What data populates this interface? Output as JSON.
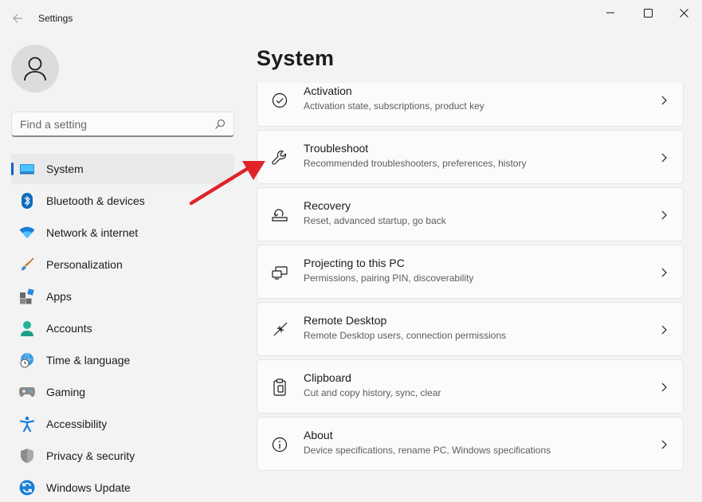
{
  "window": {
    "app_title": "Settings",
    "back_icon": "back-arrow-icon",
    "controls": [
      "minimize-icon",
      "maximize-icon",
      "close-icon"
    ]
  },
  "sidebar": {
    "avatar_icon": "user-icon",
    "search": {
      "placeholder": "Find a setting",
      "value": "",
      "icon": "search-icon"
    },
    "items": [
      {
        "label": "System",
        "icon": "system-icon",
        "active": true
      },
      {
        "label": "Bluetooth & devices",
        "icon": "bluetooth-icon"
      },
      {
        "label": "Network & internet",
        "icon": "wifi-icon"
      },
      {
        "label": "Personalization",
        "icon": "brush-icon"
      },
      {
        "label": "Apps",
        "icon": "apps-icon"
      },
      {
        "label": "Accounts",
        "icon": "accounts-icon"
      },
      {
        "label": "Time & language",
        "icon": "globe-clock-icon"
      },
      {
        "label": "Gaming",
        "icon": "gamepad-icon"
      },
      {
        "label": "Accessibility",
        "icon": "accessibility-icon"
      },
      {
        "label": "Privacy & security",
        "icon": "shield-icon"
      },
      {
        "label": "Windows Update",
        "icon": "update-icon"
      }
    ]
  },
  "main": {
    "title": "System",
    "cards": [
      {
        "title": "Activation",
        "desc": "Activation state, subscriptions, product key",
        "icon": "check-circle-icon"
      },
      {
        "title": "Troubleshoot",
        "desc": "Recommended troubleshooters, preferences, history",
        "icon": "wrench-icon"
      },
      {
        "title": "Recovery",
        "desc": "Reset, advanced startup, go back",
        "icon": "recovery-icon"
      },
      {
        "title": "Projecting to this PC",
        "desc": "Permissions, pairing PIN, discoverability",
        "icon": "projecting-icon"
      },
      {
        "title": "Remote Desktop",
        "desc": "Remote Desktop users, connection permissions",
        "icon": "remote-desktop-icon"
      },
      {
        "title": "Clipboard",
        "desc": "Cut and copy history, sync, clear",
        "icon": "clipboard-icon"
      },
      {
        "title": "About",
        "desc": "Device specifications, rename PC, Windows specifications",
        "icon": "info-icon"
      }
    ]
  },
  "colors": {
    "accent": "#0067c0",
    "annotation_arrow": "#e0232a",
    "background": "#f3f3f3",
    "card": "#fbfbfb"
  }
}
